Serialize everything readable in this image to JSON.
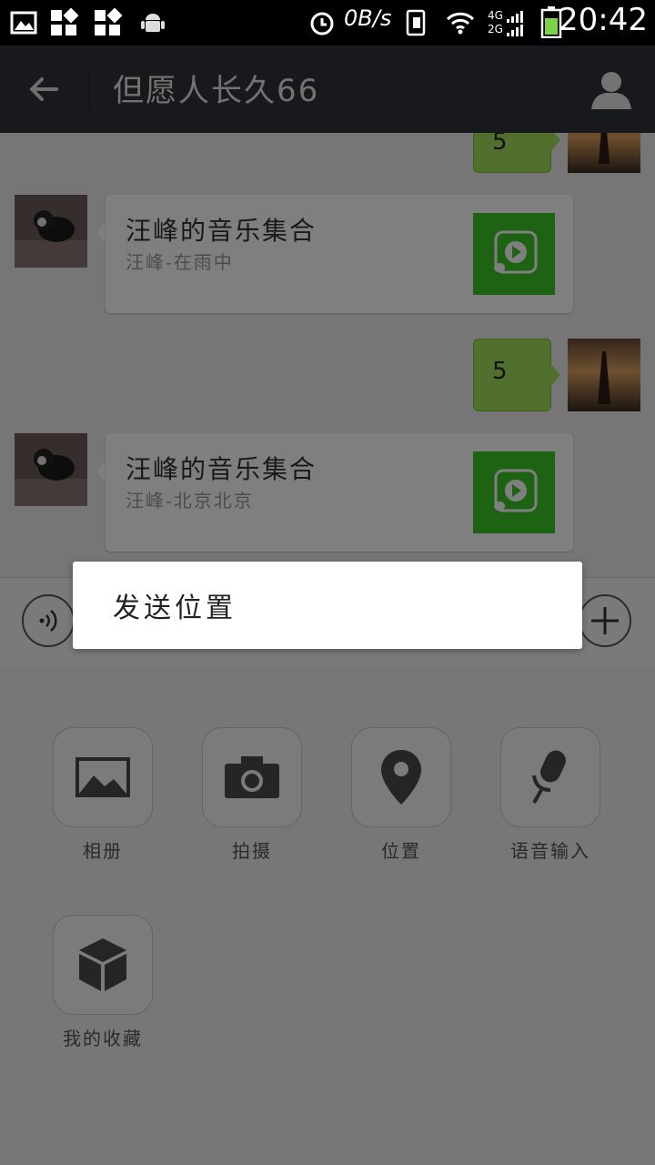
{
  "status_bar": {
    "net_speed": "0B/s",
    "network_4g": "4G",
    "network_2g": "2G",
    "time": "20:42",
    "icons": [
      "gallery-icon",
      "apps-grid-icon",
      "apps-grid-alt-icon",
      "android-icon",
      "alarm-icon",
      "sim-icon",
      "wifi-icon",
      "signal-icon",
      "battery-icon"
    ]
  },
  "header": {
    "title": "但愿人长久66",
    "back_icon": "arrow-left-icon",
    "profile_icon": "person-icon"
  },
  "chat": {
    "messages": [
      {
        "side": "right",
        "type": "text",
        "text": "5",
        "partial": true
      },
      {
        "side": "left",
        "type": "music",
        "title": "汪峰的音乐集合",
        "subtitle": "汪峰-在雨中"
      },
      {
        "side": "right",
        "type": "text",
        "text": "5"
      },
      {
        "side": "left",
        "type": "music",
        "title": "汪峰的音乐集合",
        "subtitle": "汪峰-北京北京"
      }
    ]
  },
  "input_bar": {
    "voice_icon": "voice-waves-icon",
    "plus_icon": "plus-icon"
  },
  "panel": {
    "items": [
      {
        "label": "相册",
        "icon": "image-icon"
      },
      {
        "label": "拍摄",
        "icon": "camera-icon"
      },
      {
        "label": "位置",
        "icon": "location-pin-icon"
      },
      {
        "label": "语音输入",
        "icon": "microphone-icon"
      },
      {
        "label": "我的收藏",
        "icon": "cube-icon"
      }
    ]
  },
  "popup": {
    "item": "发送位置"
  },
  "colors": {
    "title_bar": "#2e3338",
    "green_bubble": "#a3e15a",
    "music_green": "#3dc429"
  }
}
